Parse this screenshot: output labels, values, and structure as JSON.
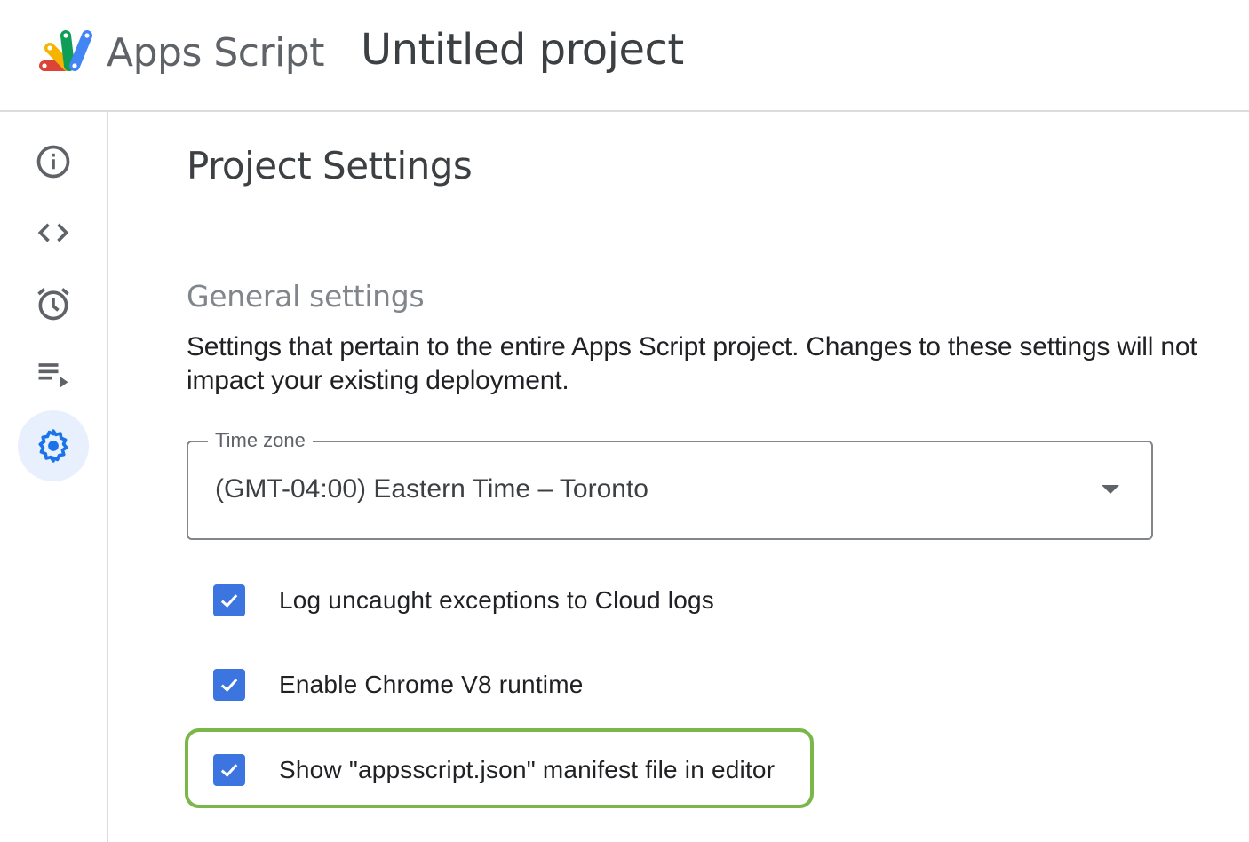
{
  "header": {
    "app_name": "Apps Script",
    "project_title": "Untitled project",
    "logo_colors": [
      "#db4437",
      "#f4b400",
      "#0f9d58",
      "#4285f4"
    ]
  },
  "sidebar": {
    "items": [
      {
        "name": "overview",
        "icon": "info-icon",
        "active": false
      },
      {
        "name": "editor",
        "icon": "code-icon",
        "active": false
      },
      {
        "name": "triggers",
        "icon": "alarm-clock-icon",
        "active": false
      },
      {
        "name": "executions",
        "icon": "playlist-play-icon",
        "active": false
      },
      {
        "name": "project-settings",
        "icon": "gear-icon",
        "active": true
      }
    ],
    "active_color": "#1a73e8",
    "active_bg": "#e8f0fe"
  },
  "main": {
    "page_title": "Project Settings",
    "section_title": "General settings",
    "section_description": "Settings that pertain to the entire Apps Script project. Changes to these settings will not impact your existing deployment.",
    "time_zone": {
      "label": "Time zone",
      "value": "(GMT-04:00) Eastern Time – Toronto"
    },
    "checkboxes": [
      {
        "label": "Log uncaught exceptions to Cloud logs",
        "checked": true
      },
      {
        "label": "Enable Chrome V8 runtime",
        "checked": true
      },
      {
        "label": "Show \"appsscript.json\" manifest file in editor",
        "checked": true,
        "highlighted": true
      }
    ],
    "checkbox_color": "#3c74e0",
    "highlight_color": "#7ab648"
  }
}
